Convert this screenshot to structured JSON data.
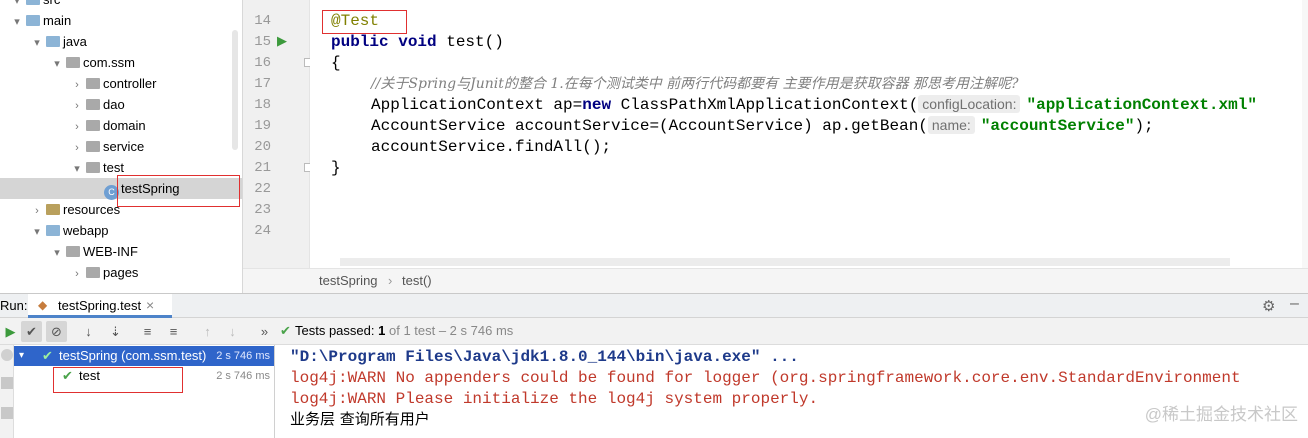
{
  "tree": {
    "items": [
      {
        "label": "src",
        "depth": 1,
        "arrow": "▾",
        "type": "blue"
      },
      {
        "label": "main",
        "depth": 1,
        "arrow": "▾",
        "type": "blue"
      },
      {
        "label": "java",
        "depth": 2,
        "arrow": "▾",
        "type": "blue"
      },
      {
        "label": "com.ssm",
        "depth": 3,
        "arrow": "▾",
        "type": "gray"
      },
      {
        "label": "controller",
        "depth": 4,
        "arrow": "›",
        "type": "gray"
      },
      {
        "label": "dao",
        "depth": 4,
        "arrow": "›",
        "type": "gray"
      },
      {
        "label": "domain",
        "depth": 4,
        "arrow": "›",
        "type": "gray"
      },
      {
        "label": "service",
        "depth": 4,
        "arrow": "›",
        "type": "gray"
      },
      {
        "label": "test",
        "depth": 4,
        "arrow": "▾",
        "type": "gray"
      },
      {
        "label": "testSpring",
        "depth": 5,
        "arrow": "",
        "type": "class",
        "selected": true
      },
      {
        "label": "resources",
        "depth": 2,
        "arrow": "›",
        "type": "res"
      },
      {
        "label": "webapp",
        "depth": 2,
        "arrow": "▾",
        "type": "web"
      },
      {
        "label": "WEB-INF",
        "depth": 3,
        "arrow": "▾",
        "type": "gray"
      },
      {
        "label": "pages",
        "depth": 4,
        "arrow": "›",
        "type": "gray"
      }
    ]
  },
  "editor": {
    "line_numbers": [
      "14",
      "15",
      "16",
      "17",
      "18",
      "19",
      "20",
      "21",
      "22",
      "23",
      "24"
    ],
    "annotation": "@Test",
    "line15_kw": "public void",
    "line15_rest": " test()",
    "line16": "{",
    "comment": "//关于Spring与Junit的整合 1.在每个测试类中 前两行代码都要有 主要作用是获取容器 那思考用注解呢?",
    "line18_a": "ApplicationContext ap=",
    "line18_kw": "new",
    "line18_b": " ClassPathXmlApplicationContext(",
    "line18_hint": "configLocation:",
    "line18_str": "\"applicationContext.xml\"",
    "line19_a": "AccountService accountService=(AccountService) ap.getBean(",
    "line19_hint": "name:",
    "line19_str": "\"accountService\"",
    "line19_end": ");",
    "line20": "accountService.findAll();",
    "line21": "}",
    "breadcrumb_class": "testSpring",
    "breadcrumb_sep": "›",
    "breadcrumb_method": "test()"
  },
  "run": {
    "label": "Run:",
    "tab": "testSpring.test",
    "close": "×",
    "status_bold": "Tests passed:",
    "status_count": "1",
    "status_rest": "of 1 test – 2 s 746 ms"
  },
  "tests": {
    "root_label": "testSpring (com.ssm.test)",
    "root_time": "2 s 746 ms",
    "child_label": "test",
    "child_time": "2 s 746 ms"
  },
  "console": {
    "lines": [
      "\"D:\\Program Files\\Java\\jdk1.8.0_144\\bin\\java.exe\" ...",
      "log4j:WARN No appenders could be found for logger (org.springframework.core.env.StandardEnvironment",
      "log4j:WARN Please initialize the log4j system properly.",
      "业务层 查询所有用户"
    ]
  },
  "watermark": "@稀土掘金技术社区"
}
